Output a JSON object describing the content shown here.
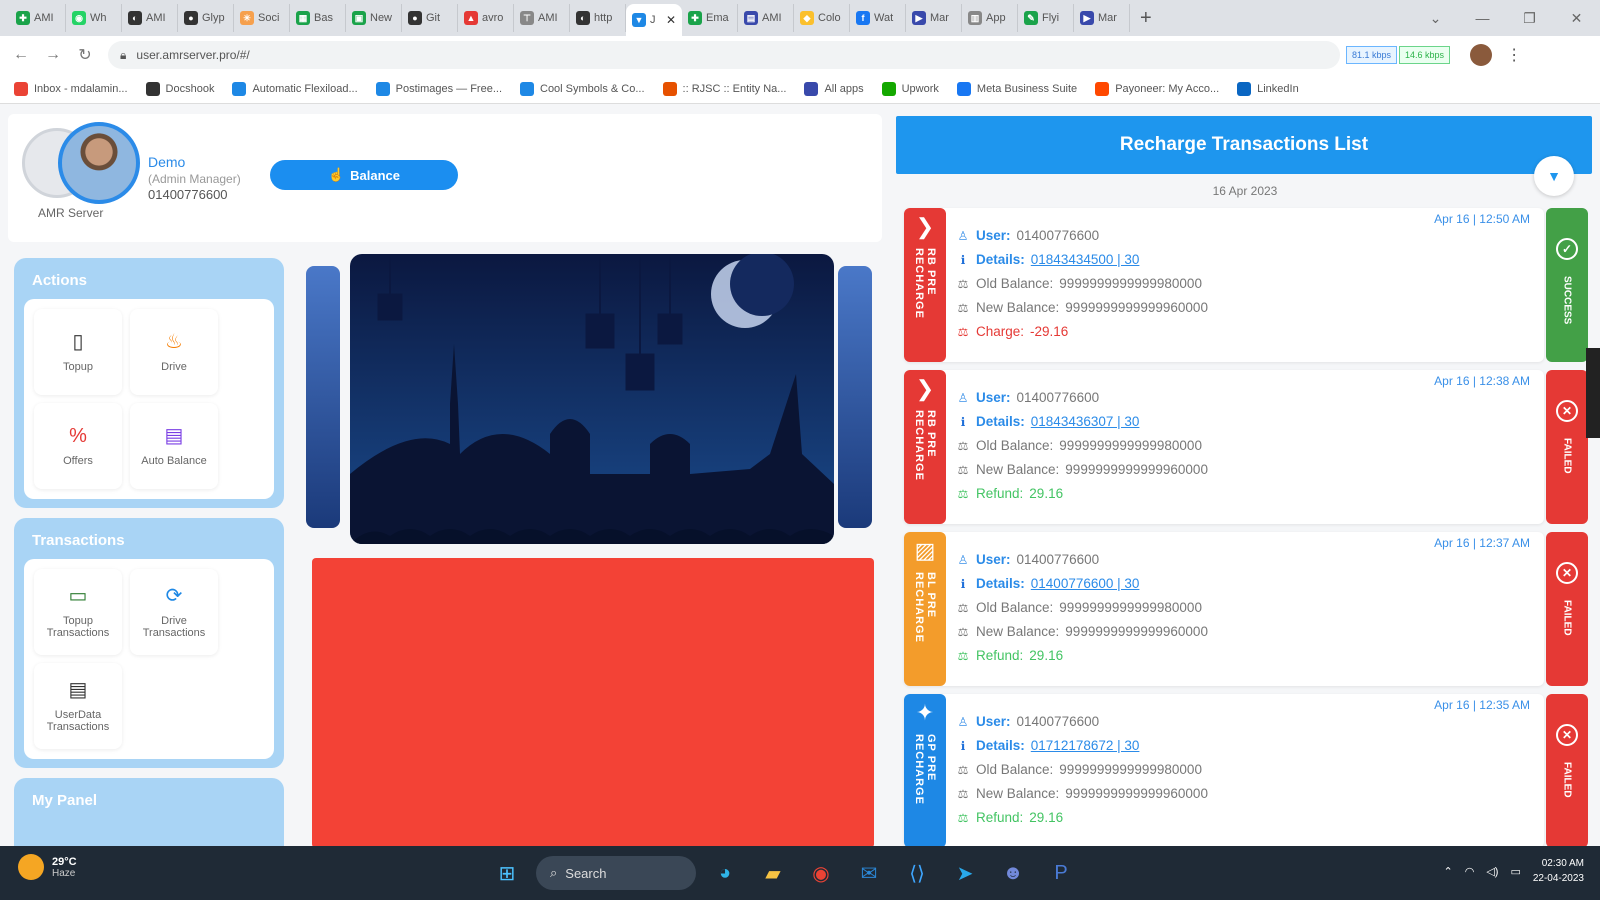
{
  "browser": {
    "tabs": [
      {
        "label": "AMI",
        "color": "#1aa34a",
        "glyph": "✚"
      },
      {
        "label": "Wh",
        "color": "#25d366",
        "glyph": "◉"
      },
      {
        "label": "AMI",
        "color": "#333333",
        "glyph": "◐"
      },
      {
        "label": "Glyp",
        "color": "#333333",
        "glyph": "●"
      },
      {
        "label": "Soci",
        "color": "#f6a04d",
        "glyph": "✳"
      },
      {
        "label": "Bas",
        "color": "#1aa34a",
        "glyph": "▦"
      },
      {
        "label": "New",
        "color": "#1aa34a",
        "glyph": "▣"
      },
      {
        "label": "Git",
        "color": "#333333",
        "glyph": "●"
      },
      {
        "label": "avro",
        "color": "#e53935",
        "glyph": "▲"
      },
      {
        "label": "AMI",
        "color": "#888888",
        "glyph": "⊤"
      },
      {
        "label": "http",
        "color": "#333333",
        "glyph": "◐"
      },
      {
        "label": "J",
        "color": "#1e88e5",
        "glyph": "▼",
        "active": true
      },
      {
        "label": "Ema",
        "color": "#1aa34a",
        "glyph": "✚"
      },
      {
        "label": "AMI",
        "color": "#3949ab",
        "glyph": "▤"
      },
      {
        "label": "Colo",
        "color": "#fbc02d",
        "glyph": "◆"
      },
      {
        "label": "Wat",
        "color": "#1877f2",
        "glyph": "f"
      },
      {
        "label": "Mar",
        "color": "#3949ab",
        "glyph": "▶"
      },
      {
        "label": "App",
        "color": "#888888",
        "glyph": "▥"
      },
      {
        "label": "Flyi",
        "color": "#1aa34a",
        "glyph": "✎"
      },
      {
        "label": "Mar",
        "color": "#3949ab",
        "glyph": "▶"
      }
    ],
    "new_tab": "+",
    "url": "user.amrserver.pro/#/",
    "speed_down": "81.1 kbps",
    "speed_up": "14.6 kbps",
    "bookmarks": [
      {
        "label": "Inbox - mdalamin...",
        "color": "#ea4335"
      },
      {
        "label": "Docshook",
        "color": "#333333"
      },
      {
        "label": "Automatic Flexiload...",
        "color": "#1e88e5"
      },
      {
        "label": "Postimages — Free...",
        "color": "#1e88e5"
      },
      {
        "label": "Cool Symbols & Co...",
        "color": "#1e88e5"
      },
      {
        "label": ":: RJSC :: Entity Na...",
        "color": "#e65100"
      },
      {
        "label": "All apps",
        "color": "#3949ab"
      },
      {
        "label": "Upwork",
        "color": "#14a800"
      },
      {
        "label": "Meta Business Suite",
        "color": "#1877f2"
      },
      {
        "label": "Payoneer: My Acco...",
        "color": "#ff4800"
      },
      {
        "label": "LinkedIn",
        "color": "#0a66c2"
      }
    ]
  },
  "profile": {
    "name": "Demo",
    "role": "(Admin Manager)",
    "phone": "01400776600",
    "server": "AMR Server",
    "balance_button": "Balance"
  },
  "actions": {
    "title": "Actions",
    "items": [
      {
        "label": "Topup",
        "icon": "phone-icon",
        "glyph": "▯",
        "color": "#333333"
      },
      {
        "label": "Drive",
        "icon": "fire-icon",
        "glyph": "♨",
        "color": "#f57c00"
      },
      {
        "label": "Offers",
        "icon": "percent-icon",
        "glyph": "%",
        "color": "#e53935"
      },
      {
        "label": "Auto Balance",
        "icon": "money-icon",
        "glyph": "▤",
        "color": "#7b3fe4"
      }
    ]
  },
  "transactions_panel": {
    "title": "Transactions",
    "items": [
      {
        "label": "Topup Transactions",
        "icon": "card-icon",
        "glyph": "▭",
        "color": "#2e7d32"
      },
      {
        "label": "Drive Transactions",
        "icon": "refresh-icon",
        "glyph": "⟳",
        "color": "#1e88e5"
      },
      {
        "label": "UserData Transactions",
        "icon": "clipboard-icon",
        "glyph": "▤",
        "color": "#333333"
      }
    ]
  },
  "my_panel": {
    "title": "My Panel"
  },
  "recharge_list": {
    "title": "Recharge Transactions List",
    "date": "16 Apr 2023",
    "labels": {
      "user": "User:",
      "details": "Details:",
      "old_balance": "Old Balance:",
      "new_balance": "New Balance:",
      "charge": "Charge:",
      "refund": "Refund:"
    },
    "items": [
      {
        "time": "Apr 16 | 12:50 AM",
        "operator": "RB PRE RECHARGE",
        "op_color": "#e53935",
        "op_glyph": "❯",
        "user": "01400776600",
        "details": "01843434500 | 30",
        "old_balance": "9999999999999980000",
        "new_balance": "9999999999999960000",
        "fee_type": "charge",
        "amount": "-29.16",
        "status": "SUCCESS",
        "status_color": "#43a047",
        "status_glyph": "✓"
      },
      {
        "time": "Apr 16 | 12:38 AM",
        "operator": "RB PRE RECHARGE",
        "op_color": "#e53935",
        "op_glyph": "❯",
        "user": "01400776600",
        "details": "01843436307 | 30",
        "old_balance": "9999999999999980000",
        "new_balance": "9999999999999960000",
        "fee_type": "refund",
        "amount": "29.16",
        "status": "FAILED",
        "status_color": "#e53935",
        "status_glyph": "✕"
      },
      {
        "time": "Apr 16 | 12:37 AM",
        "operator": "BL PRE RECHARGE",
        "op_color": "#f39c2b",
        "op_glyph": "▨",
        "user": "01400776600",
        "details": "01400776600 | 30",
        "old_balance": "9999999999999980000",
        "new_balance": "9999999999999960000",
        "fee_type": "refund",
        "amount": "29.16",
        "status": "FAILED",
        "status_color": "#e53935",
        "status_glyph": "✕"
      },
      {
        "time": "Apr 16 | 12:35 AM",
        "operator": "GP PRE RECHARGE",
        "op_color": "#1e88e5",
        "op_glyph": "✦",
        "user": "01400776600",
        "details": "01712178672 | 30",
        "old_balance": "9999999999999980000",
        "new_balance": "9999999999999960000",
        "fee_type": "refund",
        "amount": "29.16",
        "status": "FAILED",
        "status_color": "#e53935",
        "status_glyph": "✕"
      }
    ]
  },
  "taskbar": {
    "temperature": "29°C",
    "weather": "Haze",
    "search": "Search",
    "time": "02:30 AM",
    "date": "22-04-2023"
  }
}
